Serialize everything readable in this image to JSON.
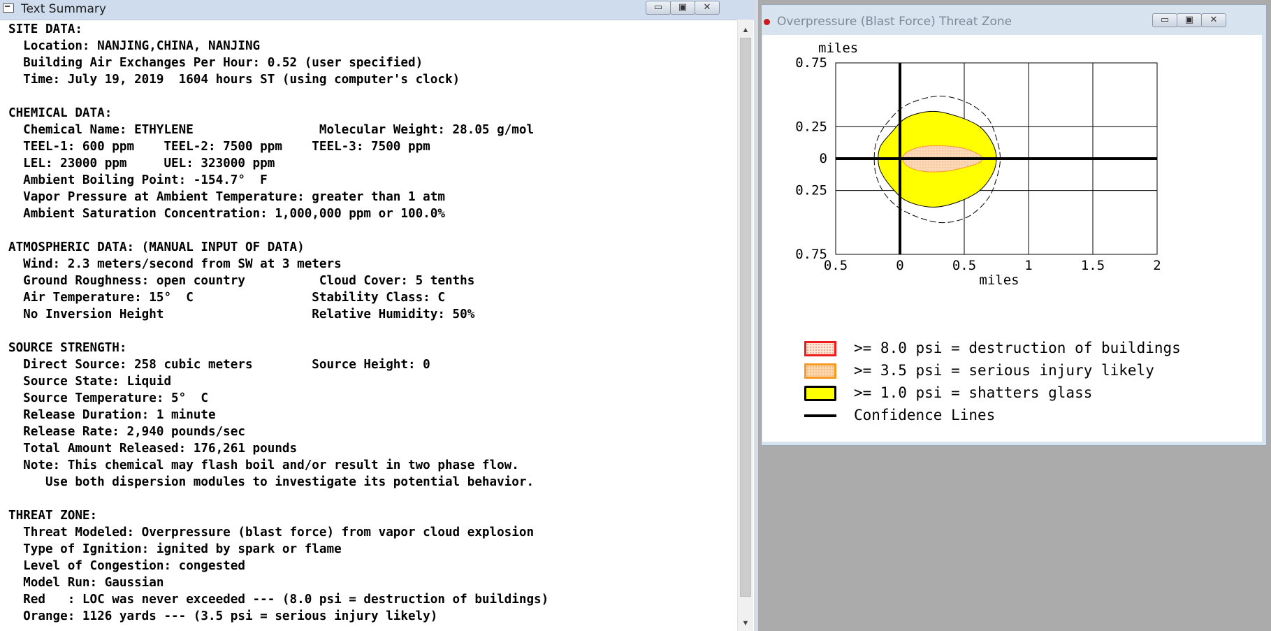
{
  "text_window": {
    "title": "Text Summary",
    "controls": {
      "minimize": "minimize",
      "maximize": "maximize",
      "close": "close"
    },
    "lines": [
      "SITE DATA:",
      "  Location: NANJING,CHINA, NANJING",
      "  Building Air Exchanges Per Hour: 0.52 (user specified)",
      "  Time: July 19, 2019  1604 hours ST (using computer's clock)",
      "",
      "CHEMICAL DATA:",
      "  Chemical Name: ETHYLENE                 Molecular Weight: 28.05 g/mol",
      "  TEEL-1: 600 ppm    TEEL-2: 7500 ppm    TEEL-3: 7500 ppm",
      "  LEL: 23000 ppm     UEL: 323000 ppm",
      "  Ambient Boiling Point: -154.7°  F",
      "  Vapor Pressure at Ambient Temperature: greater than 1 atm",
      "  Ambient Saturation Concentration: 1,000,000 ppm or 100.0%",
      "",
      "ATMOSPHERIC DATA: (MANUAL INPUT OF DATA)",
      "  Wind: 2.3 meters/second from SW at 3 meters",
      "  Ground Roughness: open country          Cloud Cover: 5 tenths",
      "  Air Temperature: 15°  C                Stability Class: C",
      "  No Inversion Height                    Relative Humidity: 50%",
      "",
      "SOURCE STRENGTH:",
      "  Direct Source: 258 cubic meters        Source Height: 0",
      "  Source State: Liquid",
      "  Source Temperature: 5°  C",
      "  Release Duration: 1 minute",
      "  Release Rate: 2,940 pounds/sec",
      "  Total Amount Released: 176,261 pounds",
      "  Note: This chemical may flash boil and/or result in two phase flow.",
      "     Use both dispersion modules to investigate its potential behavior.",
      "",
      "THREAT ZONE:",
      "  Threat Modeled: Overpressure (blast force) from vapor cloud explosion",
      "  Type of Ignition: ignited by spark or flame",
      "  Level of Congestion: congested",
      "  Model Run: Gaussian",
      "  Red   : LOC was never exceeded --- (8.0 psi = destruction of buildings)",
      "  Orange: 1126 yards --- (3.5 psi = serious injury likely)"
    ]
  },
  "threat_window": {
    "title": "Overpressure (Blast Force) Threat Zone",
    "legend": [
      {
        "label": ">= 8.0 psi = destruction of buildings",
        "color": "#ee1c1c",
        "fill": "#fde4d4"
      },
      {
        "label": ">= 3.5 psi = serious injury likely",
        "color": "#f79a24",
        "fill": "#fcd7ad"
      },
      {
        "label": ">= 1.0 psi = shatters glass",
        "color": "#000000",
        "fill": "#ffff00"
      },
      {
        "label": "Confidence Lines",
        "color": "#000000"
      }
    ]
  },
  "chart_data": {
    "type": "area",
    "xlabel": "miles",
    "ylabel": "miles",
    "xlim": [
      -0.5,
      2
    ],
    "ylim": [
      -0.75,
      0.75
    ],
    "x_ticks": [
      -0.5,
      0,
      0.5,
      1,
      1.5,
      2
    ],
    "x_tick_labels": [
      "0.5",
      "0",
      "0.5",
      "1",
      "1.5",
      "2"
    ],
    "y_ticks": [
      0.75,
      0.25,
      0,
      -0.25,
      -0.75
    ],
    "y_tick_labels": [
      "0.75",
      "0.25",
      "0",
      "0.25",
      "0.75"
    ],
    "grid": true,
    "series": [
      {
        "name": ">= 1.0 psi = shatters glass",
        "color": "#000000",
        "fill": "#ffff00",
        "points": [
          [
            -0.17,
            0.0
          ],
          [
            -0.15,
            0.1
          ],
          [
            -0.07,
            0.2
          ],
          [
            0.05,
            0.32
          ],
          [
            0.25,
            0.37
          ],
          [
            0.45,
            0.33
          ],
          [
            0.62,
            0.25
          ],
          [
            0.72,
            0.12
          ],
          [
            0.75,
            0.0
          ],
          [
            0.72,
            -0.12
          ],
          [
            0.62,
            -0.25
          ],
          [
            0.45,
            -0.34
          ],
          [
            0.25,
            -0.38
          ],
          [
            0.05,
            -0.33
          ],
          [
            -0.07,
            -0.22
          ],
          [
            -0.15,
            -0.1
          ]
        ]
      },
      {
        "name": ">= 3.5 psi = serious injury likely",
        "color": "#f79a24",
        "fill": "#fcd7ad",
        "points": [
          [
            0.02,
            0.0
          ],
          [
            0.06,
            0.055
          ],
          [
            0.18,
            0.095
          ],
          [
            0.35,
            0.1
          ],
          [
            0.5,
            0.08
          ],
          [
            0.62,
            0.03
          ],
          [
            0.63,
            0.0
          ],
          [
            0.62,
            -0.03
          ],
          [
            0.5,
            -0.07
          ],
          [
            0.35,
            -0.1
          ],
          [
            0.18,
            -0.1
          ],
          [
            0.06,
            -0.06
          ]
        ]
      },
      {
        "name": "Confidence Lines",
        "color": "#000000",
        "points": [
          [
            -0.2,
            0.0
          ],
          [
            -0.18,
            0.14
          ],
          [
            -0.1,
            0.28
          ],
          [
            0.05,
            0.42
          ],
          [
            0.3,
            0.49
          ],
          [
            0.52,
            0.44
          ],
          [
            0.68,
            0.32
          ],
          [
            0.75,
            0.16
          ],
          [
            0.78,
            0.0
          ],
          [
            0.75,
            -0.16
          ],
          [
            0.68,
            -0.32
          ],
          [
            0.52,
            -0.46
          ],
          [
            0.3,
            -0.5
          ],
          [
            0.05,
            -0.42
          ],
          [
            -0.1,
            -0.3
          ],
          [
            -0.18,
            -0.15
          ]
        ]
      }
    ]
  }
}
